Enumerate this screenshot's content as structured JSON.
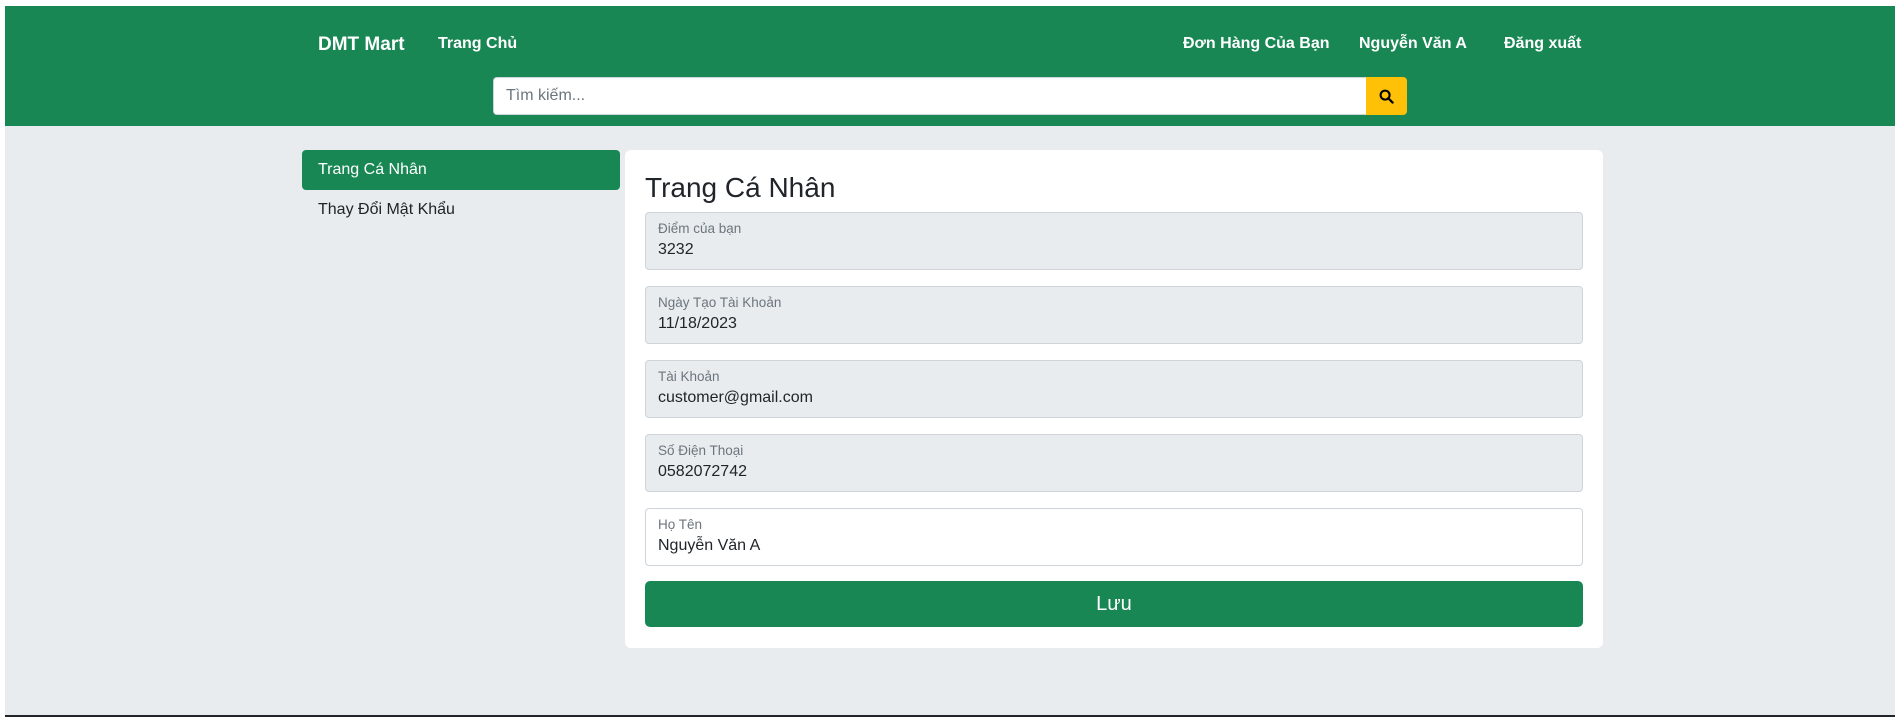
{
  "header": {
    "brand": "DMT Mart",
    "nav_home": "Trang Chủ",
    "nav_orders": "Đơn Hàng Của Bạn",
    "nav_user": "Nguyễn Văn A",
    "nav_logout": "Đăng xuất",
    "search_placeholder": "Tìm kiếm...",
    "search_icon": "search-icon"
  },
  "sidebar": {
    "items": [
      {
        "label": "Trang Cá Nhân",
        "active": true
      },
      {
        "label": "Thay Đổi Mật Khẩu",
        "active": false
      }
    ]
  },
  "profile": {
    "title": "Trang Cá Nhân",
    "fields": [
      {
        "label": "Điểm của bạn",
        "value": "3232",
        "readonly": true
      },
      {
        "label": "Ngày Tạo Tài Khoản",
        "value": "11/18/2023",
        "readonly": true
      },
      {
        "label": "Tài Khoản",
        "value": "customer@gmail.com",
        "readonly": true
      },
      {
        "label": "Số Điện Thoại",
        "value": "0582072742",
        "readonly": true
      },
      {
        "label": "Họ Tên",
        "value": "Nguyễn Văn A",
        "readonly": false
      }
    ],
    "save_label": "Lưu"
  },
  "colors": {
    "brand_green": "#198754",
    "search_button": "#ffc107",
    "page_background": "#e9ecef"
  }
}
